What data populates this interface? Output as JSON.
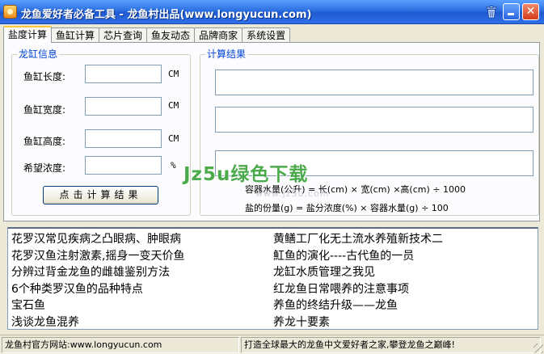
{
  "window": {
    "title": "龙鱼爱好者必备工具 - 龙鱼村出品(www.longyucun.com)"
  },
  "tabs": [
    {
      "label": "盐度计算",
      "active": true
    },
    {
      "label": "鱼缸计算",
      "active": false
    },
    {
      "label": "芯片查询",
      "active": false
    },
    {
      "label": "鱼友动态",
      "active": false
    },
    {
      "label": "品牌商家",
      "active": false
    },
    {
      "label": "系统设置",
      "active": false
    }
  ],
  "tank_info": {
    "legend": "龙缸信息",
    "length_label": "鱼缸长度:",
    "width_label": "鱼缸宽度:",
    "height_label": "鱼缸高度:",
    "concentration_label": "希望浓度:",
    "length_value": "",
    "width_value": "",
    "height_value": "",
    "concentration_value": "",
    "unit_cm": "CM",
    "unit_percent": "%",
    "calc_button": "点击计算结果"
  },
  "results": {
    "legend": "计算结果",
    "formula_volume": "容器水量(公升) = 长(cm) × 宽(cm) ×高(cm) ÷ 1000",
    "formula_salt": "盐的份量(g) = 盐分浓度(%) × 容器水量(g) ÷ 100"
  },
  "watermark": {
    "main": "Jz5u绿色下载",
    "sub": "www.Jz5u.com"
  },
  "links": {
    "left": [
      "花罗汉常见疾病之凸眼病、肿眼病",
      "花罗汉鱼注射激素,摇身一变天价鱼",
      "分辨过背金龙鱼的雌雄鉴别方法",
      "6个种类罗汉鱼的品种特点",
      "宝石鱼",
      "浅谈龙鱼混养"
    ],
    "right": [
      "黄鳝工厂化无土流水养殖新技术二",
      "魟鱼的演化----古代鱼的一员",
      "龙缸水质管理之我见",
      "红龙鱼日常喂养的注意事项",
      "养鱼的终结升级——龙鱼",
      "养龙十要素"
    ]
  },
  "status": {
    "left": "龙鱼村官方网站:www.longyucun.com",
    "right": "打造全球最大的龙鱼中文爱好者之家,攀登龙鱼之巅峰!"
  },
  "colors": {
    "titlebar": "#2c6fe0",
    "legend_text": "#0046d5",
    "tab_highlight": "#ffc83c",
    "watermark": "#3aa33a"
  }
}
